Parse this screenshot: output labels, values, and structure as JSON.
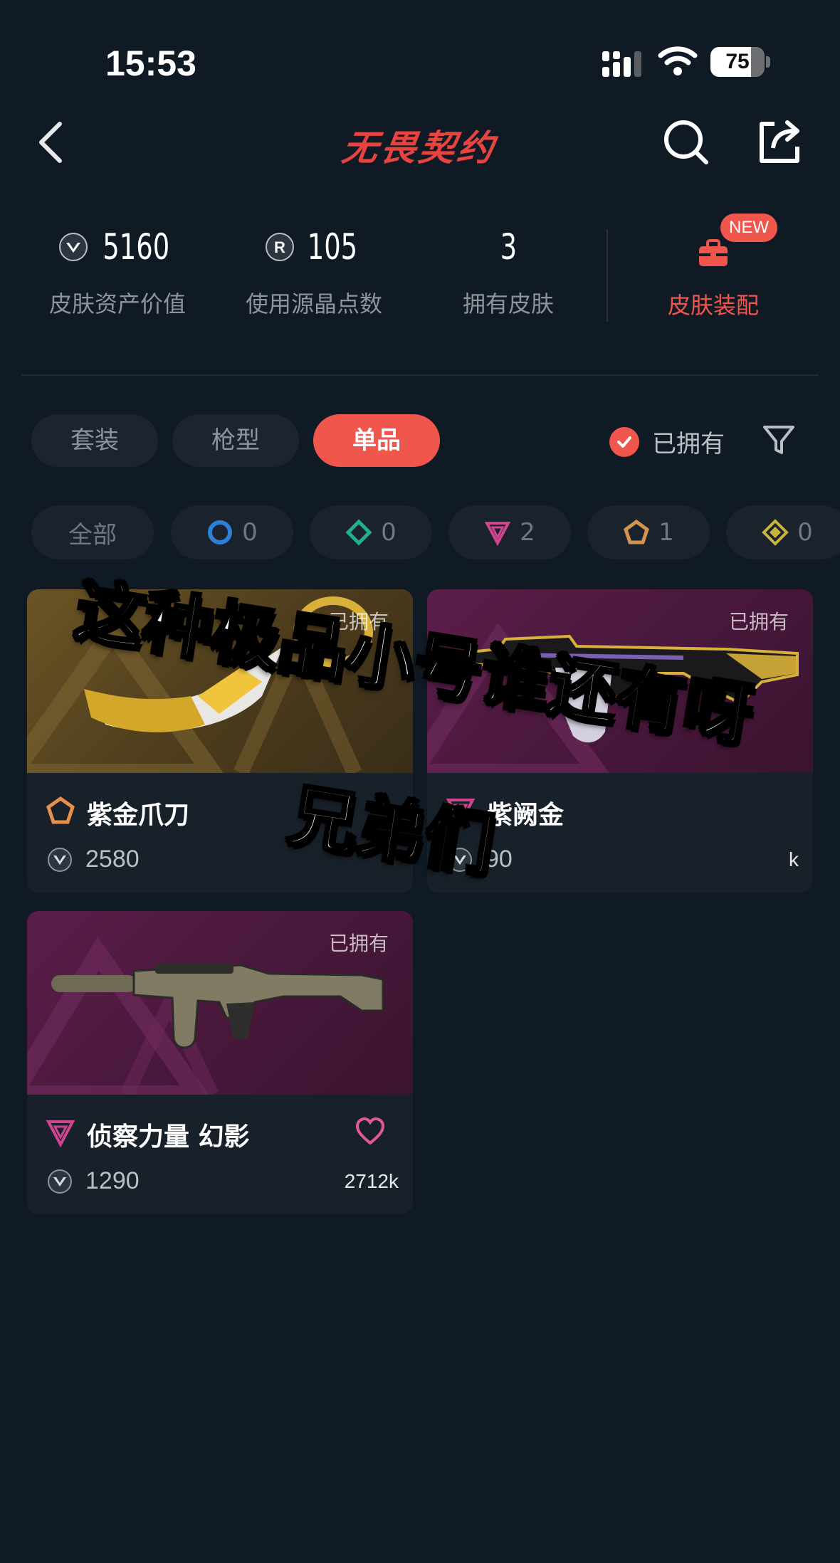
{
  "status_bar": {
    "time": "15:53",
    "battery": "75",
    "battery_level": 0.75
  },
  "nav": {
    "title": "无畏契约"
  },
  "stats": {
    "asset_value": {
      "value": "5160",
      "label": "皮肤资产价值"
    },
    "radianite": {
      "value": "105",
      "label": "使用源晶点数"
    },
    "owned_skins": {
      "value": "3",
      "label": "拥有皮肤"
    },
    "outfit": {
      "label": "皮肤装配",
      "badge": "NEW"
    }
  },
  "tabs": [
    {
      "label": "套装",
      "active": false
    },
    {
      "label": "枪型",
      "active": false
    },
    {
      "label": "单品",
      "active": true
    }
  ],
  "owned_filter": {
    "label": "已拥有",
    "checked": true
  },
  "rarity_chips": [
    {
      "label": "全部"
    },
    {
      "count": "0",
      "color": "#2f7fd6",
      "icon": "circle-tier-icon"
    },
    {
      "count": "0",
      "color": "#1fae8e",
      "icon": "diamond-tier-icon"
    },
    {
      "count": "2",
      "color": "#d0458f",
      "icon": "triangle-tier-icon"
    },
    {
      "count": "1",
      "color": "#d49350",
      "icon": "pentagon-tier-icon"
    },
    {
      "count": "0",
      "color": "#c9b23d",
      "icon": "rhombus-tier-icon"
    }
  ],
  "cards": [
    {
      "name": "紫金爪刀",
      "price": "2580",
      "owned_label": "已拥有",
      "tier_color": "#e8904a",
      "likes": ""
    },
    {
      "name": "紫阙金",
      "price": "90",
      "owned_label": "已拥有",
      "tier_color": "#d0458f",
      "likes": "k"
    },
    {
      "name": "侦察力量 幻影",
      "price": "1290",
      "owned_label": "已拥有",
      "tier_color": "#d0458f",
      "likes": "2712k"
    }
  ],
  "caption": {
    "line1": "这种极品小号谁还有呀",
    "line2": "兄弟们"
  },
  "colors": {
    "accent": "#f0564b",
    "background": "#101a24"
  }
}
